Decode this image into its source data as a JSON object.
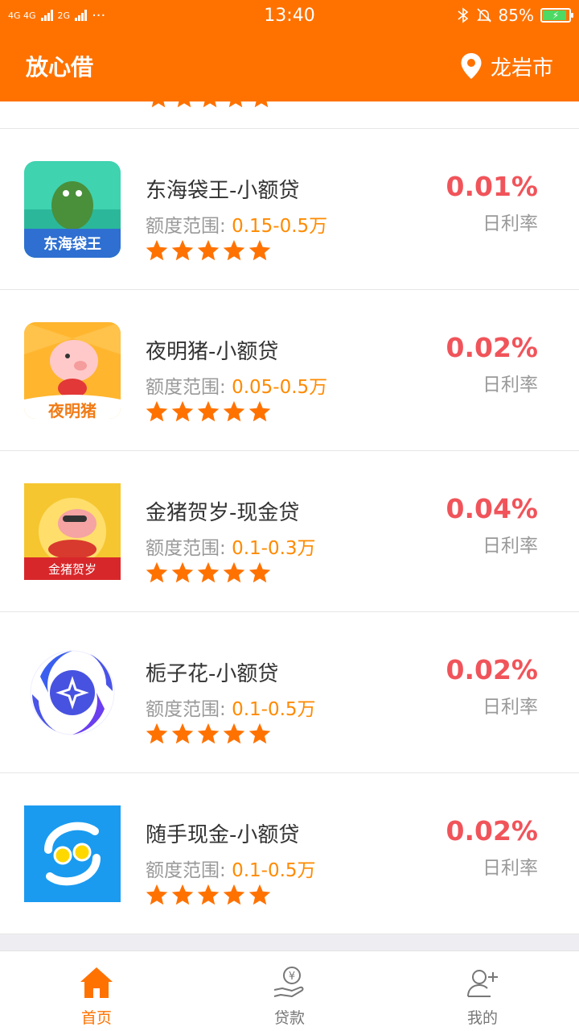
{
  "status_bar": {
    "network_1": "4G 4G",
    "network_2": "2G",
    "dots": "···",
    "time": "13:40",
    "battery": "85%"
  },
  "app": {
    "title": "放心借",
    "city": "龙岩市"
  },
  "products": [
    {
      "name": "东海袋王-小额贷",
      "range_label": "额度范围:",
      "range_value": "0.15-0.5万",
      "rate": "0.01%",
      "rate_label": "日利率",
      "logo_text": "东海袋王",
      "rating": 5
    },
    {
      "name": "夜明猪-小额贷",
      "range_label": "额度范围:",
      "range_value": "0.05-0.5万",
      "rate": "0.02%",
      "rate_label": "日利率",
      "logo_text": "夜明猪",
      "rating": 5
    },
    {
      "name": "金猪贺岁-现金贷",
      "range_label": "额度范围:",
      "range_value": "0.1-0.3万",
      "rate": "0.04%",
      "rate_label": "日利率",
      "logo_text": "金猪贺岁",
      "rating": 5
    },
    {
      "name": "栀子花-小额贷",
      "range_label": "额度范围:",
      "range_value": "0.1-0.5万",
      "rate": "0.02%",
      "rate_label": "日利率",
      "logo_text": "",
      "rating": 5
    },
    {
      "name": "随手现金-小额贷",
      "range_label": "额度范围:",
      "range_value": "0.1-0.5万",
      "rate": "0.02%",
      "rate_label": "日利率",
      "logo_text": "",
      "rating": 5
    }
  ],
  "tabs": [
    {
      "label": "首页",
      "icon": "home-icon",
      "active": true
    },
    {
      "label": "贷款",
      "icon": "loan-icon",
      "active": false
    },
    {
      "label": "我的",
      "icon": "add-user-icon",
      "active": false
    }
  ],
  "colors": {
    "brand": "#ff7200",
    "rate": "#f0545a",
    "range_value": "#ff8a00",
    "star": "#ff7200"
  }
}
